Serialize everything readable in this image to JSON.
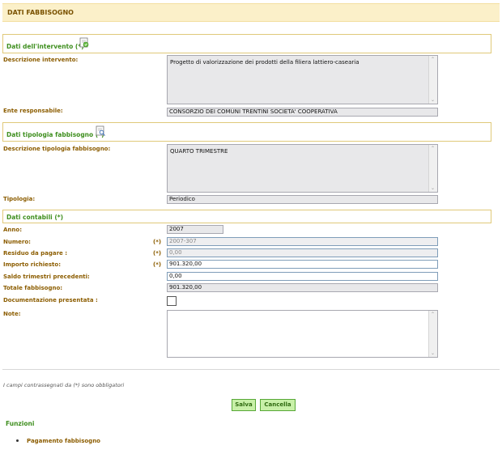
{
  "header": {
    "title": "DATI FABBISOGNO"
  },
  "sections": {
    "intervento": "Dati dell'intervento (*)",
    "tipologia": "Dati tipologia fabbisogno (*)",
    "contabili": "Dati contabili (*)"
  },
  "fields": {
    "descrizione_intervento": {
      "label": "Descrizione intervento:",
      "value": "Progetto di valorizzazione dei prodotti della filiera lattiero-casearia"
    },
    "ente_responsabile": {
      "label": "Ente responsabile:",
      "value": "CONSORZIO DEI COMUNI TRENTINI SOCIETA' COOPERATIVA"
    },
    "descrizione_tipologia": {
      "label": "Descrizione tipologia fabbisogno:",
      "value": "QUARTO TRIMESTRE"
    },
    "tipologia": {
      "label": "Tipologia:",
      "value": "Periodico"
    },
    "anno": {
      "label": "Anno:",
      "value": "2007"
    },
    "numero": {
      "label": "Numero:",
      "req": "(*)",
      "value": "2007-307"
    },
    "residuo": {
      "label": "Residuo da pagare :",
      "req": "(*)",
      "value": "0,00"
    },
    "importo": {
      "label": "Importo richiesto:",
      "req": "(*)",
      "value": "901.320,00"
    },
    "saldo": {
      "label": "Saldo trimestri precedenti:",
      "value": "0,00"
    },
    "totale": {
      "label": "Totale fabbisogno:",
      "value": "901.320,00"
    },
    "documentazione": {
      "label": "Documentazione presentata :",
      "checked": false
    },
    "note": {
      "label": "Note:",
      "value": ""
    }
  },
  "footer": {
    "required_note": "I campi contrassegnati da (*) sono obbligatori",
    "save_label": "Salva",
    "cancel_label": "Cancella"
  },
  "funzioni": {
    "title": "Funzioni",
    "items": [
      "Pagamento fabbisogno"
    ]
  },
  "colors": {
    "header_bg": "#fbf0c9",
    "label": "#8c5d00",
    "section_title": "#3f8f1f",
    "button_bg": "#c8f0a8"
  },
  "icons": {
    "intervento": "edit-document-icon",
    "tipologia": "search-document-icon"
  }
}
